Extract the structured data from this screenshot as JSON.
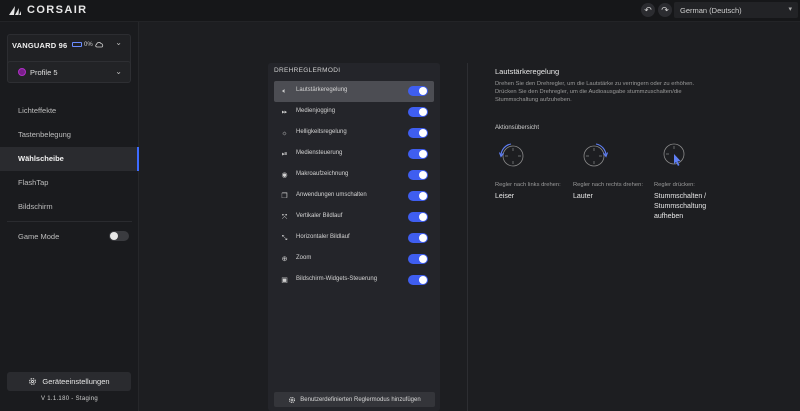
{
  "app": {
    "brand": "CORSAIR",
    "language": "German (Deutsch)",
    "undo_icon": "undo-icon",
    "redo_icon": "redo-icon"
  },
  "device": {
    "name": "VANGUARD 96",
    "battery": "0%"
  },
  "profile": {
    "name": "Profile 5",
    "color": "#b02fc7"
  },
  "sidebar": {
    "items": [
      {
        "label": "Lichteffekte",
        "active": false
      },
      {
        "label": "Tastenbelegung",
        "active": false
      },
      {
        "label": "Wählscheibe",
        "active": true
      },
      {
        "label": "FlashTap",
        "active": false
      },
      {
        "label": "Bildschirm",
        "active": false
      }
    ],
    "game_mode_label": "Game Mode",
    "game_mode_on": false,
    "settings_label": "Geräteeinstellungen",
    "version": "V 1.1.180 - Staging"
  },
  "panel": {
    "title": "DREHREGLERMODI",
    "modes": [
      {
        "label": "Lautstärkeregelung",
        "icon": "volume-icon",
        "enabled": true,
        "active": true
      },
      {
        "label": "Medienjogging",
        "icon": "fast-forward-icon",
        "enabled": true,
        "active": false
      },
      {
        "label": "Helligkeitsregelung",
        "icon": "brightness-icon",
        "enabled": true,
        "active": false
      },
      {
        "label": "Mediensteuerung",
        "icon": "play-skip-icon",
        "enabled": true,
        "active": false
      },
      {
        "label": "Makroaufzeichnung",
        "icon": "record-icon",
        "enabled": true,
        "active": false
      },
      {
        "label": "Anwendungen umschalten",
        "icon": "app-switch-icon",
        "enabled": true,
        "active": false
      },
      {
        "label": "Vertikaler Bildlauf",
        "icon": "vertical-scroll-icon",
        "enabled": true,
        "active": false
      },
      {
        "label": "Horizontaler Bildlauf",
        "icon": "horizontal-scroll-icon",
        "enabled": true,
        "active": false
      },
      {
        "label": "Zoom",
        "icon": "zoom-icon",
        "enabled": true,
        "active": false
      },
      {
        "label": "Bildschirm-Widgets-Steuerung",
        "icon": "widget-icon",
        "enabled": true,
        "active": false
      }
    ],
    "add_label": "Benutzerdefinierten Reglermodus hinzufügen"
  },
  "detail": {
    "title": "Lautstärkeregelung",
    "description": "Drehen Sie den Drehregler, um die Lautstärke zu verringern oder zu erhöhen. Drücken Sie den Drehregler, um die Audioausgabe stummzuschalten/die Stummschaltung aufzuheben.",
    "overview_title": "Aktionsübersicht",
    "actions": [
      {
        "label": "Regler nach links drehen:",
        "value": "Leiser",
        "icon": "rotate-left-dial-icon"
      },
      {
        "label": "Regler nach rechts drehen:",
        "value": "Lauter",
        "icon": "rotate-right-dial-icon"
      },
      {
        "label": "Regler drücken:",
        "value": "Stummschalten / Stummschaltung aufheben",
        "icon": "press-dial-icon"
      }
    ]
  },
  "colors": {
    "accent": "#3f5ef0",
    "background": "#1d1e21",
    "panel": "#24252a"
  }
}
